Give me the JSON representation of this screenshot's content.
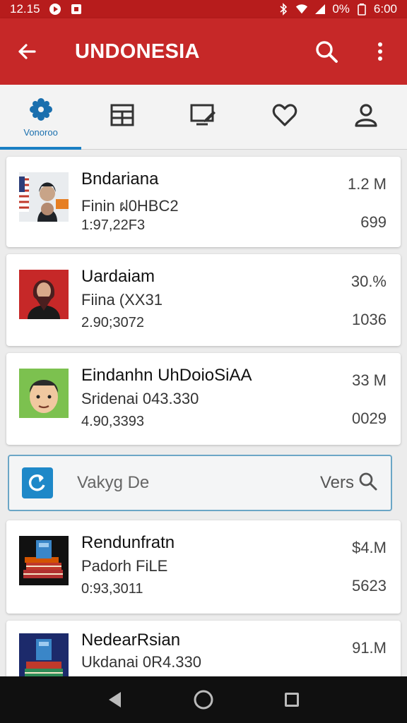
{
  "status_bar": {
    "time": "12.15",
    "battery": "0%",
    "clock_right": "6:00",
    "icons": [
      "play-icon",
      "notification-icon",
      "bluetooth-icon",
      "wifi-icon",
      "signal-icon"
    ]
  },
  "app_bar": {
    "title": "UNDONESIA",
    "back_icon": "arrow-left-icon",
    "search_icon": "search-icon",
    "more_icon": "more-vertical-icon"
  },
  "tabs": [
    {
      "label": "Vonoroo",
      "icon": "badge-icon",
      "active": true
    },
    {
      "label": "",
      "icon": "list-icon",
      "active": false
    },
    {
      "label": "",
      "icon": "edit-screen-icon",
      "active": false
    },
    {
      "label": "",
      "icon": "heart-icon",
      "active": false
    },
    {
      "label": "",
      "icon": "person-icon",
      "active": false
    }
  ],
  "items": [
    {
      "name": "Bndariana",
      "subtitle": "Finin ฝ0HBC2",
      "code": "1:97,22F3",
      "size": "1.2 M",
      "count": "699",
      "thumb": "flag-portrait-thumbnail"
    },
    {
      "name": "Uardaiam",
      "subtitle": "Fiina (XX31",
      "code": "2.90;3072",
      "size": "30.%",
      "count": "1036",
      "thumb": "hijab-portrait-thumbnail"
    },
    {
      "name": "Eindanhn UhDoioSiAA",
      "subtitle": "Sridenai 043.330",
      "code": "4.90,3393",
      "size": "33 M",
      "count": "0029",
      "thumb": "cartoon-face-thumbnail"
    },
    {
      "name": "Rendunfratn",
      "subtitle": "Padorh FiLE",
      "code": "0:93,3011",
      "size": "$4.M",
      "count": "5623",
      "thumb": "books-thumbnail"
    },
    {
      "name": "NedearRsian",
      "subtitle": "Ukdanai 0R4.330",
      "code": "",
      "size": "91.M",
      "count": "",
      "thumb": "books-thumbnail"
    }
  ],
  "search_bar": {
    "text": "Vakyg De",
    "right_label": "Vers",
    "badge_icon": "refresh-icon",
    "search_icon": "search-icon"
  },
  "nav_bar": {
    "icons": [
      "back-triangle-icon",
      "home-circle-icon",
      "recents-square-icon"
    ]
  },
  "colors": {
    "app_bar": "#c62828",
    "status_bar": "#b71c1c",
    "tab_accent": "#1a7fc4",
    "search_border": "#6ba6c6"
  }
}
